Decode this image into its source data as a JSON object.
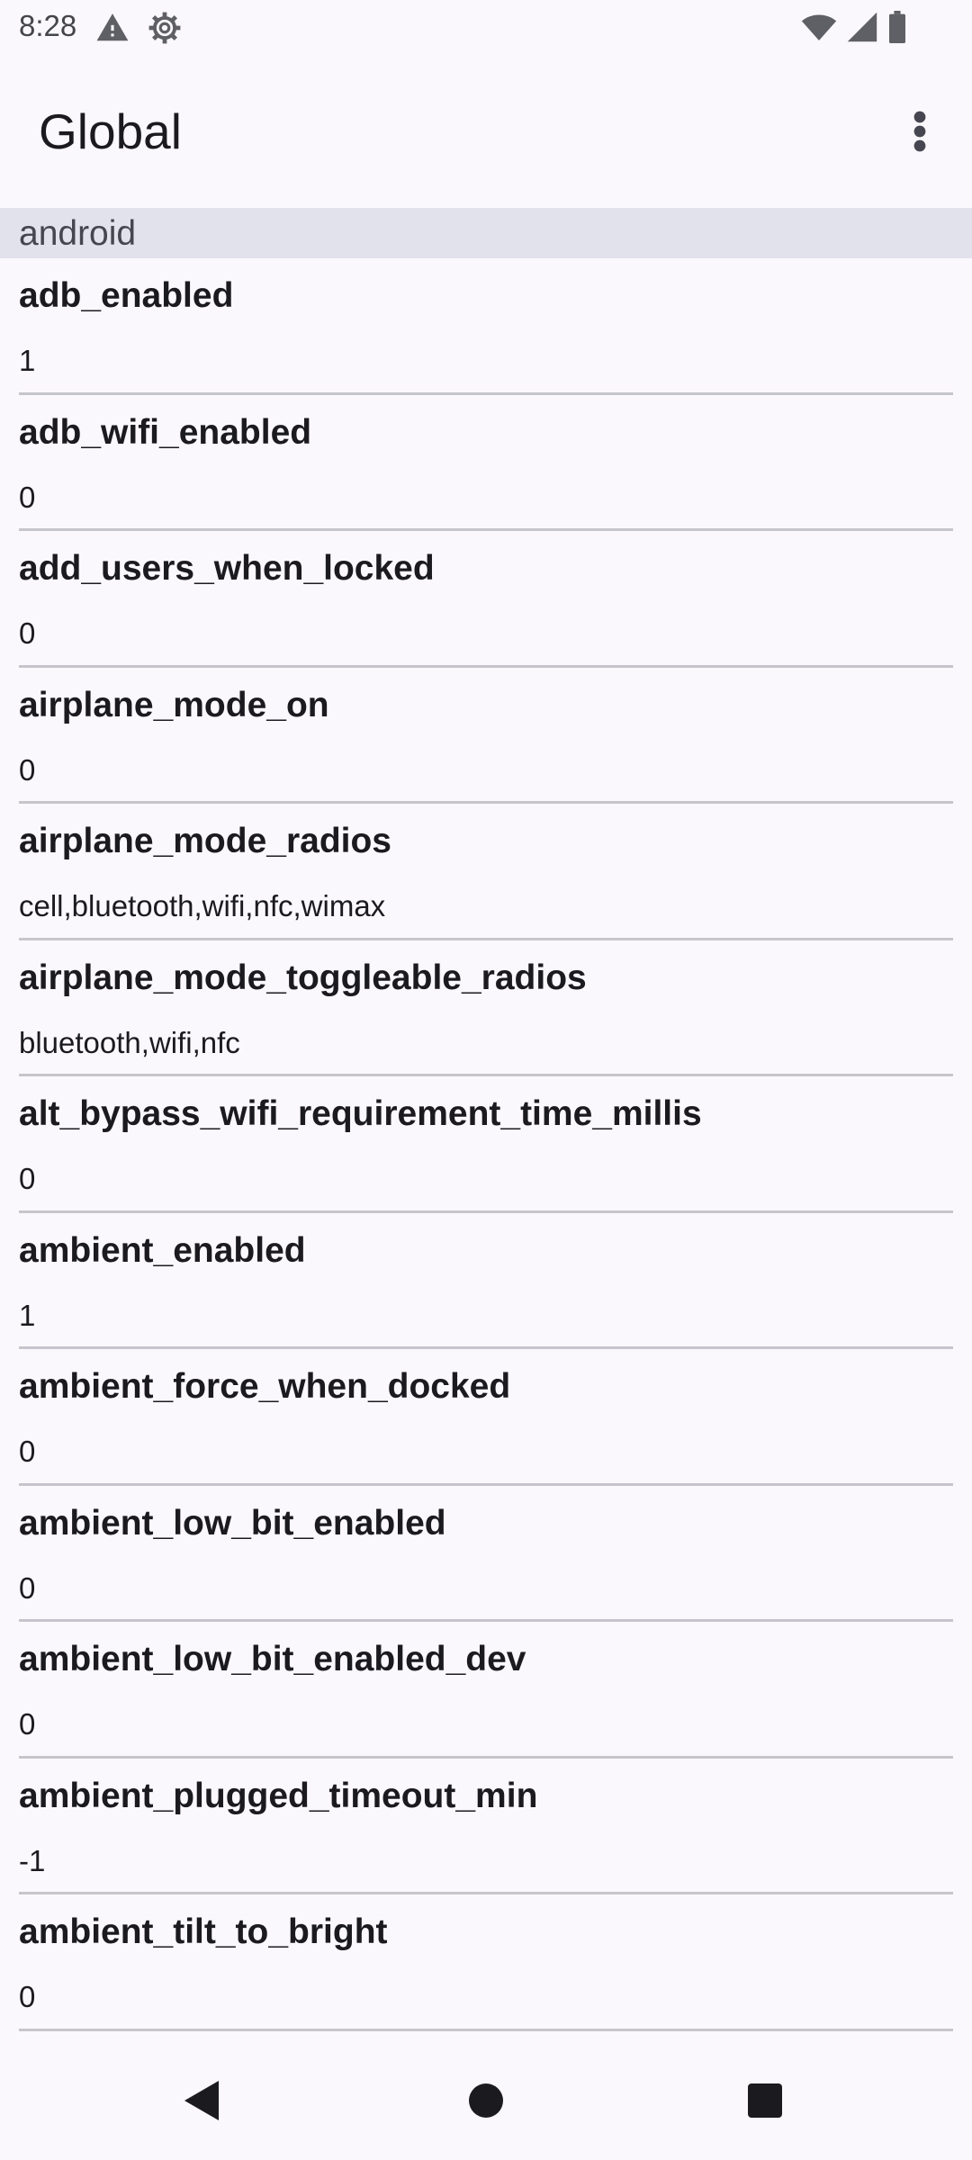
{
  "status_bar": {
    "time": "8:28",
    "left_icons": [
      "warning-icon",
      "settings-gear-icon"
    ],
    "right_icons": [
      "wifi-icon",
      "cell-signal-icon",
      "battery-icon"
    ]
  },
  "app_bar": {
    "title": "Global",
    "menu_icon": "more-vert-icon"
  },
  "section": {
    "title": "android"
  },
  "settings": [
    {
      "key": "adb_enabled",
      "value": "1"
    },
    {
      "key": "adb_wifi_enabled",
      "value": "0"
    },
    {
      "key": "add_users_when_locked",
      "value": "0"
    },
    {
      "key": "airplane_mode_on",
      "value": "0"
    },
    {
      "key": "airplane_mode_radios",
      "value": "cell,bluetooth,wifi,nfc,wimax"
    },
    {
      "key": "airplane_mode_toggleable_radios",
      "value": "bluetooth,wifi,nfc"
    },
    {
      "key": "alt_bypass_wifi_requirement_time_millis",
      "value": "0"
    },
    {
      "key": "ambient_enabled",
      "value": "1"
    },
    {
      "key": "ambient_force_when_docked",
      "value": "0"
    },
    {
      "key": "ambient_low_bit_enabled",
      "value": "0"
    },
    {
      "key": "ambient_low_bit_enabled_dev",
      "value": "0"
    },
    {
      "key": "ambient_plugged_timeout_min",
      "value": "-1"
    },
    {
      "key": "ambient_tilt_to_bright",
      "value": "0"
    }
  ],
  "nav_bar": {
    "icons": [
      "back-icon",
      "home-icon",
      "recents-icon"
    ]
  }
}
